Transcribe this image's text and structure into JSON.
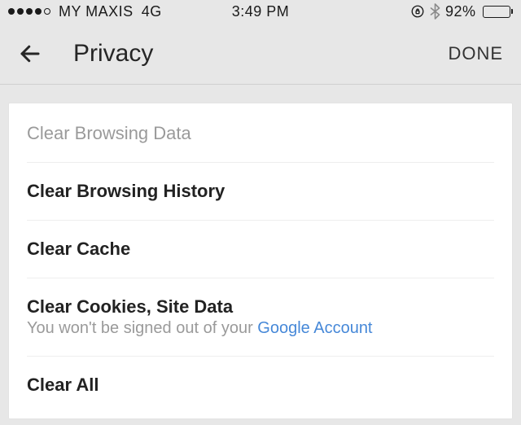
{
  "status": {
    "carrier": "MY MAXIS",
    "network": "4G",
    "time": "3:49 PM",
    "battery_pct": "92%"
  },
  "nav": {
    "title": "Privacy",
    "done": "DONE"
  },
  "section": {
    "header": "Clear Browsing Data"
  },
  "items": {
    "history": {
      "label": "Clear Browsing History"
    },
    "cache": {
      "label": "Clear Cache"
    },
    "cookies": {
      "label": "Clear Cookies, Site Data",
      "sub_prefix": "You won't be signed out of your ",
      "sub_link": "Google Account"
    },
    "all": {
      "label": "Clear All"
    }
  }
}
